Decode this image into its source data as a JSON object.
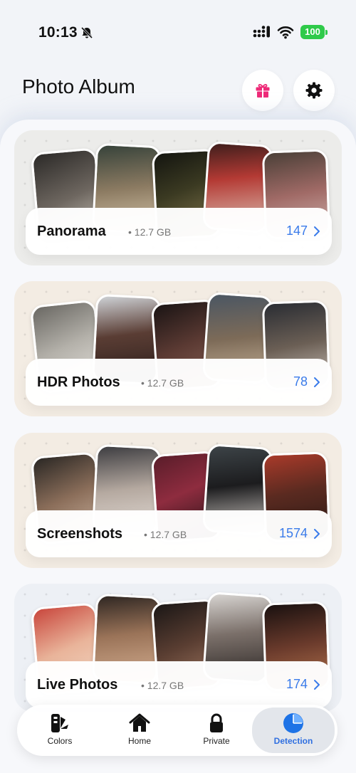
{
  "status_bar": {
    "time": "10:13",
    "battery": "100"
  },
  "header": {
    "title": "Photo Album"
  },
  "albums": [
    {
      "name": "Panorama",
      "size": "• 12.7 GB",
      "count": "147"
    },
    {
      "name": "HDR Photos",
      "size": "• 12.7 GB",
      "count": "78"
    },
    {
      "name": "Screenshots",
      "size": "• 12.7 GB",
      "count": "1574"
    },
    {
      "name": "Live Photos",
      "size": "• 12.7 GB",
      "count": "174"
    }
  ],
  "nav": {
    "tabs": [
      {
        "label": "Colors",
        "icon": "swatch-icon"
      },
      {
        "label": "Home",
        "icon": "home-icon"
      },
      {
        "label": "Private",
        "icon": "lock-icon"
      },
      {
        "label": "Detection",
        "icon": "pie-chart-icon"
      }
    ],
    "active": "Detection"
  },
  "colors": {
    "accent": "#3a7bea",
    "gift": "#ee2a78",
    "battery": "#2fca4a"
  }
}
